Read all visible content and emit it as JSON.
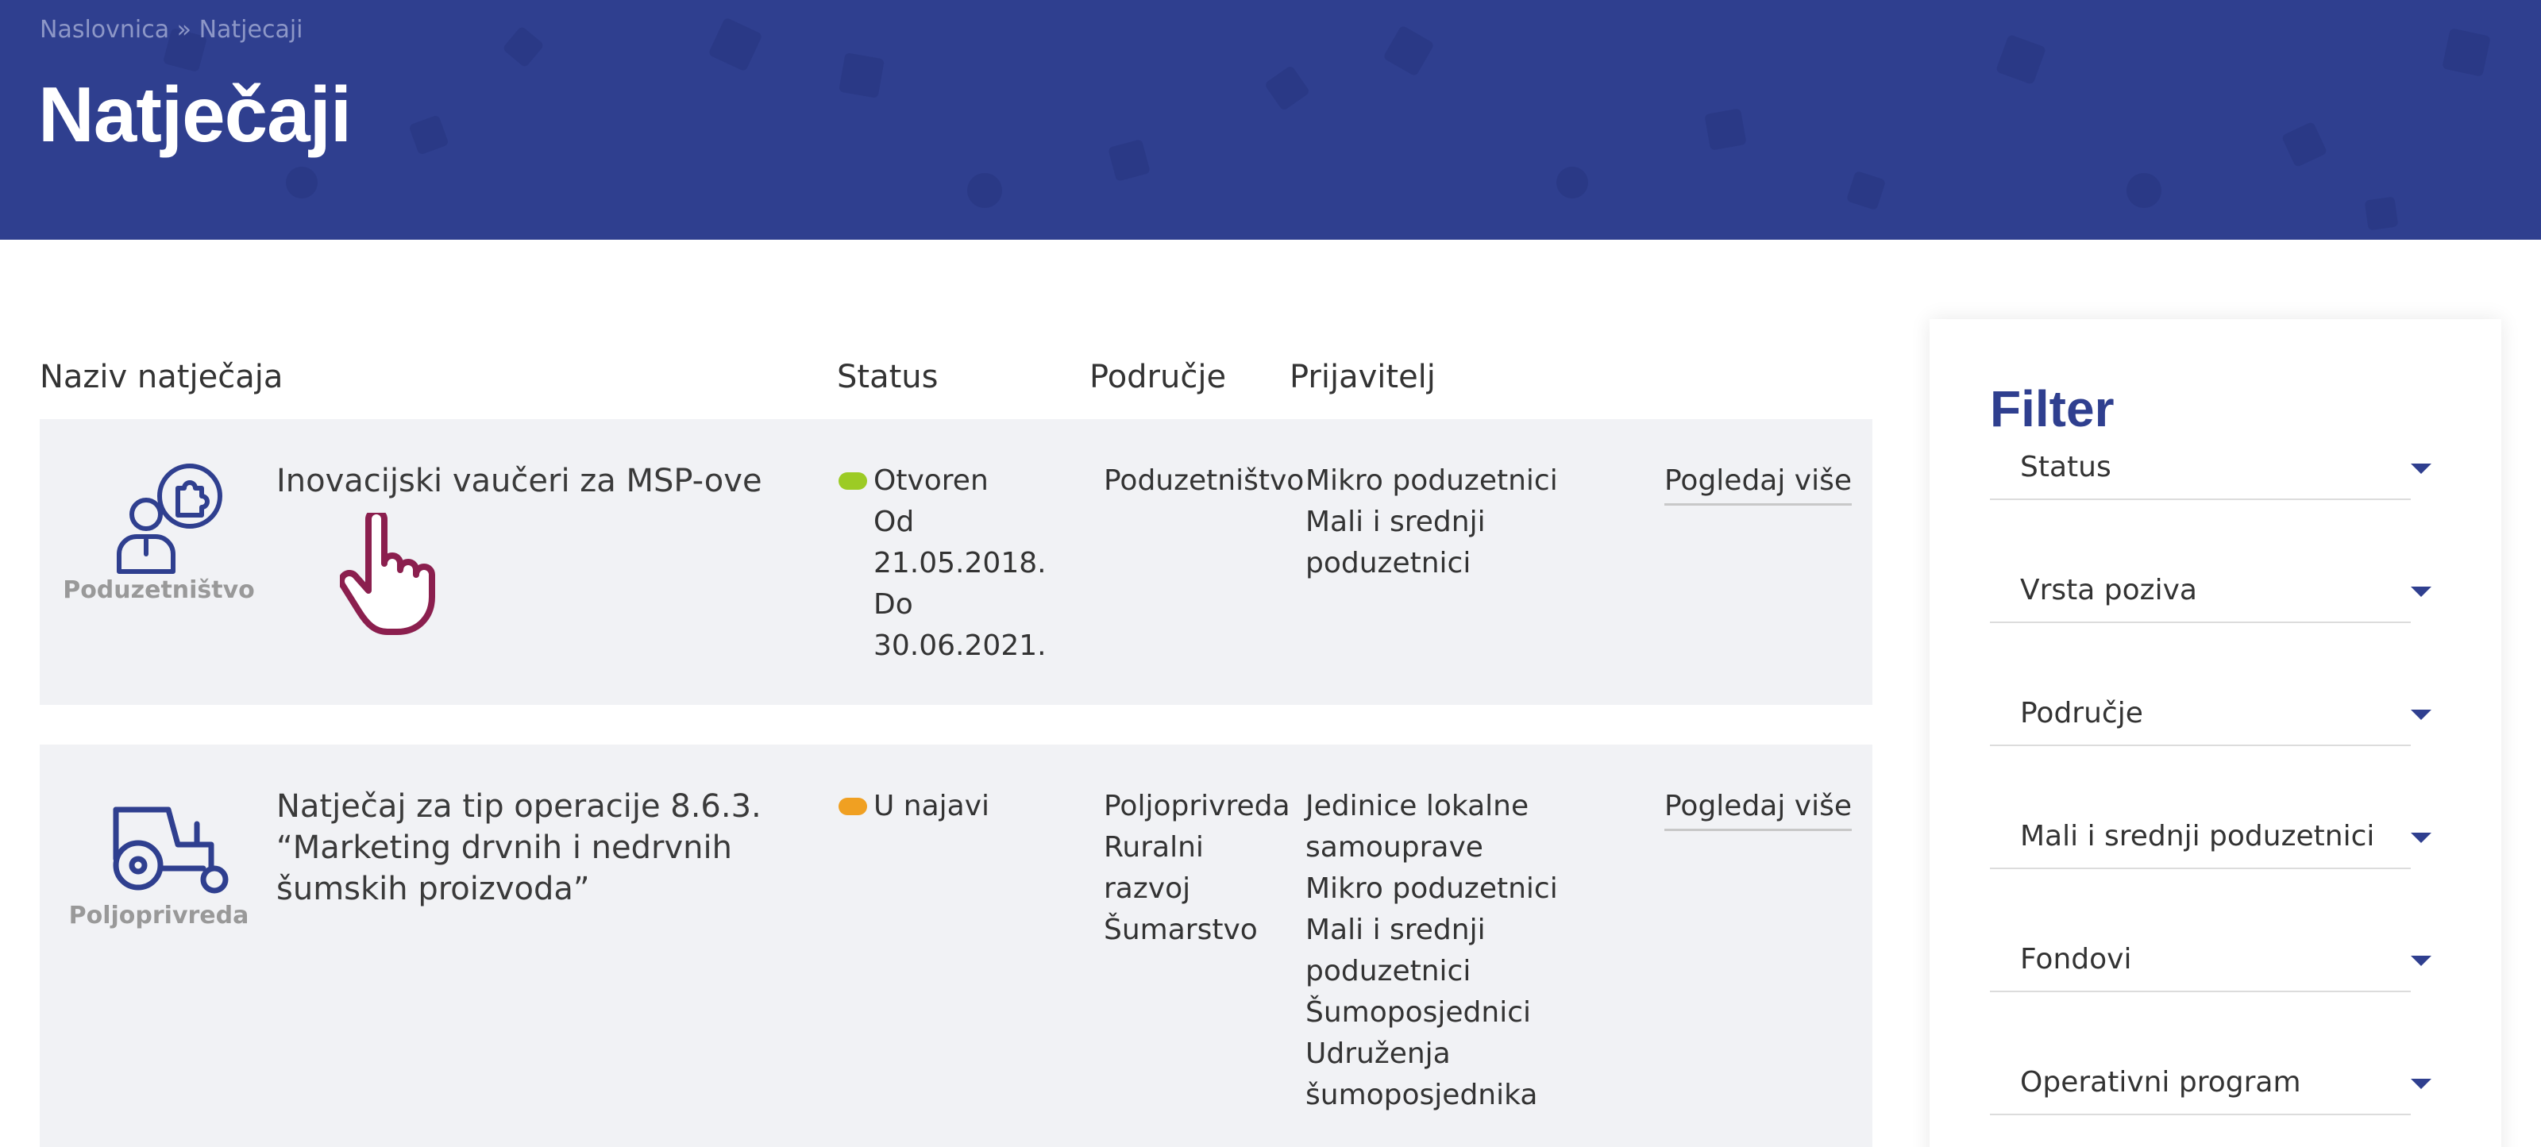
{
  "breadcrumb": {
    "home": "Naslovnica",
    "separator": "»",
    "current": "Natjecaji"
  },
  "page_title": "Natječaji",
  "table": {
    "headers": {
      "name": "Naziv natječaja",
      "status": "Status",
      "area": "Područje",
      "applicant": "Prijavitelj"
    },
    "rows": [
      {
        "icon": "person-puzzle-icon",
        "area_label": "Poduzetništvo",
        "title": "Inovacijski vaučeri za MSP-ove",
        "status": "Otvoren",
        "status_color": "#9ccb25",
        "dates": [
          "Od",
          "21.05.2018.",
          "Do",
          "30.06.2021."
        ],
        "areas": [
          "Poduzetništvo"
        ],
        "applicants": [
          "Mikro poduzetnici",
          "Mali i srednji",
          "poduzetnici"
        ],
        "more": "Pogledaj više"
      },
      {
        "icon": "tractor-icon",
        "area_label": "Poljoprivreda",
        "title": "Natječaj za tip operacije 8.6.3. “Marketing drvnih i nedrvnih šumskih proizvoda”",
        "status": "U najavi",
        "status_color": "#f0a022",
        "areas": [
          "Poljoprivreda",
          "Ruralni",
          "razvoj",
          "Šumarstvo"
        ],
        "applicants": [
          "Jedinice lokalne",
          "samouprave",
          "Mikro poduzetnici",
          "Mali i srednji",
          "poduzetnici",
          "Šumoposjednici",
          "Udruženja",
          "šumoposjednika"
        ],
        "more": "Pogledaj više"
      }
    ]
  },
  "filter": {
    "title": "Filter",
    "items": [
      "Status",
      "Vrsta poziva",
      "Područje",
      "Mali i srednji poduzetnici",
      "Fondovi",
      "Operativni program"
    ]
  },
  "colors": {
    "brand": "#2f3f8f",
    "row_bg": "#f1f2f5",
    "cursor": "#8b1f4e"
  }
}
